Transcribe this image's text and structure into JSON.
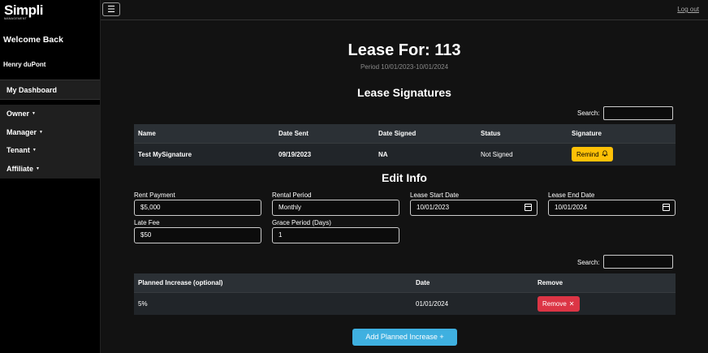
{
  "sidebar": {
    "logo_text": "Simpli",
    "logo_sub": "MANAGEMENT",
    "welcome": "Welcome Back",
    "username": "Henry duPont",
    "dashboard_label": "My Dashboard",
    "menu": [
      {
        "label": "Owner"
      },
      {
        "label": "Manager"
      },
      {
        "label": "Tenant"
      },
      {
        "label": "Affiliate"
      }
    ]
  },
  "topbar": {
    "menu_icon": "hamburger-icon",
    "logout_label": "Log out"
  },
  "header": {
    "title": "Lease For: 113",
    "period": "Period 10/01/2023-10/01/2024"
  },
  "signatures": {
    "title": "Lease Signatures",
    "search_label": "Search:",
    "search_value": "",
    "columns": [
      "Name",
      "Date Sent",
      "Date Signed",
      "Status",
      "Signature"
    ],
    "rows": [
      {
        "name": "Test MySignature",
        "date_sent": "09/19/2023",
        "date_signed": "NA",
        "status": "Not Signed",
        "action_label": "Remind"
      }
    ]
  },
  "edit_info": {
    "title": "Edit Info",
    "rent_payment": {
      "label": "Rent Payment",
      "value": "$5,000"
    },
    "rental_period": {
      "label": "Rental Period",
      "value": "Monthly"
    },
    "lease_start": {
      "label": "Lease Start Date",
      "value": "10/01/2023"
    },
    "lease_end": {
      "label": "Lease End Date",
      "value": "10/01/2024"
    },
    "late_fee": {
      "label": "Late Fee",
      "value": "$50"
    },
    "grace_period": {
      "label": "Grace Period (Days)",
      "value": "1"
    }
  },
  "increases": {
    "search_label": "Search:",
    "search_value": "",
    "columns": [
      "Planned Increase (optional)",
      "Date",
      "Remove"
    ],
    "rows": [
      {
        "increase": "5%",
        "date": "01/01/2024",
        "action_label": "Remove"
      }
    ],
    "add_label": "Add Planned Increase"
  },
  "colors": {
    "background": "#121212",
    "sidebar": "#000000",
    "remind": "#ffc107",
    "remove": "#dc3545",
    "add": "#3fb0e0"
  }
}
